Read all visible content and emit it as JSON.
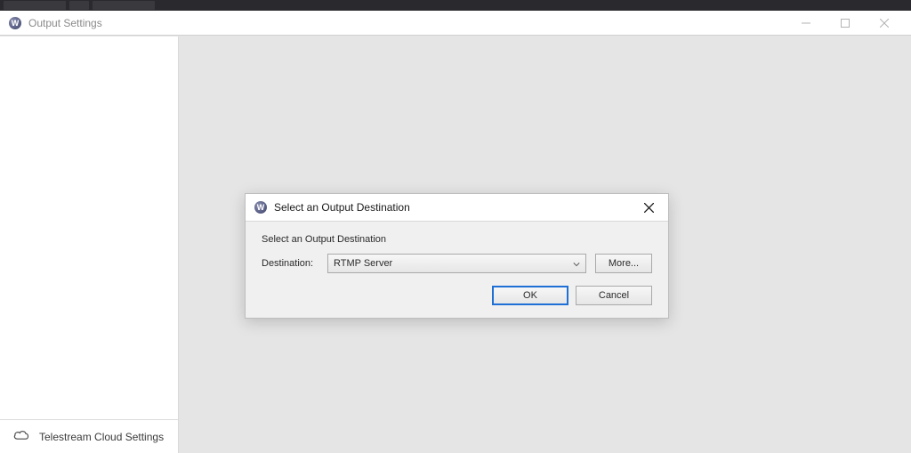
{
  "window": {
    "title": "Output Settings"
  },
  "sidebar": {
    "footer_label": "Telestream Cloud Settings"
  },
  "dialog": {
    "title": "Select an Output Destination",
    "heading": "Select an Output Destination",
    "destination_label": "Destination:",
    "destination_value": "RTMP Server",
    "more_label": "More...",
    "ok_label": "OK",
    "cancel_label": "Cancel"
  }
}
